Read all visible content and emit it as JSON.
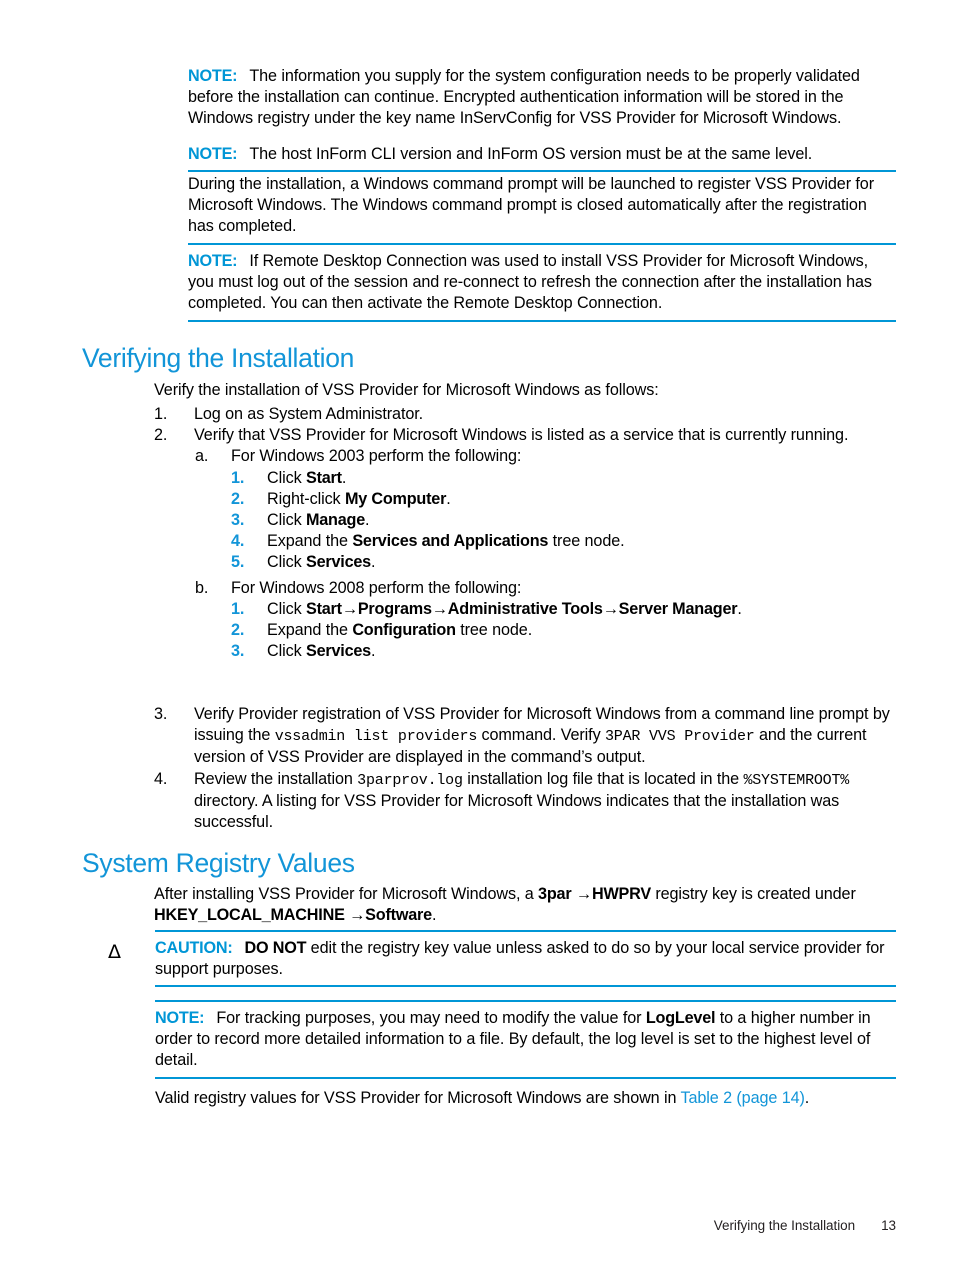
{
  "meta": {
    "accent_blue": "#0096D6",
    "heading_blue": "#1295D8",
    "rule_color": "#0096D6"
  },
  "notes": {
    "note_label": "NOTE:",
    "caution_label": "CAUTION:",
    "note1_text": "The information you supply for the system configuration needs to be properly validated before the installation can continue. Encrypted authentication information will be stored in the Windows registry under the key name InServConfig for VSS Provider for Microsoft Windows.",
    "note2_text": "The host InForm CLI version and InForm OS version must be at the same level.",
    "note3_text": "If Remote Desktop Connection was used to install VSS Provider for Microsoft Windows, you must log out of the session and re-connect to refresh the connection after the installation has completed. You can then activate the Remote Desktop Connection.",
    "caution_bold": "DO NOT",
    "caution_text": " edit the registry key value unless asked to do so by your local service provider for support purposes.",
    "note4_pre": "For tracking purposes, you may need to modify the value for ",
    "note4_bold": "LogLevel",
    "note4_post": " to a higher number in order to record more detailed information to a file. By default, the log level is set to the highest level of detail.",
    "caution_icon_glyph": "Δ"
  },
  "intro_paragraph": "During the installation, a Windows command prompt will be launched to register VSS Provider for Microsoft Windows. The Windows command prompt is closed automatically after the registration has completed.",
  "sections": {
    "verifying": {
      "title": "Verifying the Installation",
      "lead": "Verify the installation of VSS Provider for Microsoft Windows as follows:",
      "items": [
        {
          "marker": "1.",
          "text": "Log on as System Administrator."
        },
        {
          "marker": "2.",
          "text": "Verify that VSS Provider for Microsoft Windows is listed as a service that is currently running."
        },
        {
          "marker": "3.",
          "text": "Verify Provider registration of VSS Provider for Microsoft Windows from a command line prompt by issuing the vssadmin list providers command. Verify 3PAR VVS Provider and the current version of VSS Provider are displayed in the command’s output."
        },
        {
          "marker": "4.",
          "text": "Review the installation 3parprov.log installation log file that is located in the %SYSTEMROOT% directory. A listing for VSS Provider for Microsoft Windows indicates that the installation was successful."
        }
      ],
      "sub_a": {
        "marker": "a.",
        "text": "For Windows 2003 perform the following:",
        "steps": [
          {
            "marker": "1.",
            "pre": "Click ",
            "bold": "Start",
            "post": "."
          },
          {
            "marker": "2.",
            "pre": "Right-click ",
            "bold": "My Computer",
            "post": "."
          },
          {
            "marker": "3.",
            "pre": "Click ",
            "bold": "Manage",
            "post": "."
          },
          {
            "marker": "4.",
            "pre": "Expand the ",
            "bold": "Services and Applications",
            "post": " tree node."
          },
          {
            "marker": "5.",
            "pre": "Click ",
            "bold": "Services",
            "post": "."
          }
        ]
      },
      "sub_b": {
        "marker": "b.",
        "text": "For Windows 2008 perform the following:",
        "steps": [
          {
            "marker": "1.",
            "pre": "Click ",
            "bold": "Start→Programs→Administrative Tools→Server Manager",
            "post": "."
          },
          {
            "marker": "2.",
            "pre": "Expand the ",
            "bold": "Configuration",
            "post": " tree node."
          },
          {
            "marker": "3.",
            "pre": "Click ",
            "bold": "Services",
            "post": "."
          }
        ]
      },
      "item3": {
        "seg1": "Verify Provider registration of VSS Provider for Microsoft Windows from a command line prompt by issuing the ",
        "code1": "vssadmin list providers",
        "seg2": " command. Verify ",
        "code2": "3PAR VVS Provider",
        "seg3": " and the current version of VSS Provider are displayed in the command’s output."
      },
      "item4": {
        "seg1": "Review the installation ",
        "code1": "3parprov.log",
        "seg2": " installation log file that is located in the ",
        "code2": "%SYSTEMROOT%",
        "seg3": " directory. A listing for VSS Provider for Microsoft Windows indicates that the installation was successful."
      }
    },
    "registry": {
      "title": "System Registry Values",
      "para_seg1": "After installing VSS Provider for Microsoft Windows, a ",
      "para_bold1": "3par",
      "para_seg2": " →",
      "para_bold2": "HWPRV",
      "para_seg3": " registry key is created under ",
      "para_bold3": "HKEY_LOCAL_MACHINE",
      "para_seg4": " →",
      "para_bold4": "Software",
      "para_seg5": ".",
      "closing_pre": "Valid registry values for VSS Provider for Microsoft Windows are shown in ",
      "closing_link": "Table 2 (page 14)",
      "closing_post": "."
    }
  },
  "footer": {
    "chapter": "Verifying the Installation",
    "page_number": "13"
  }
}
